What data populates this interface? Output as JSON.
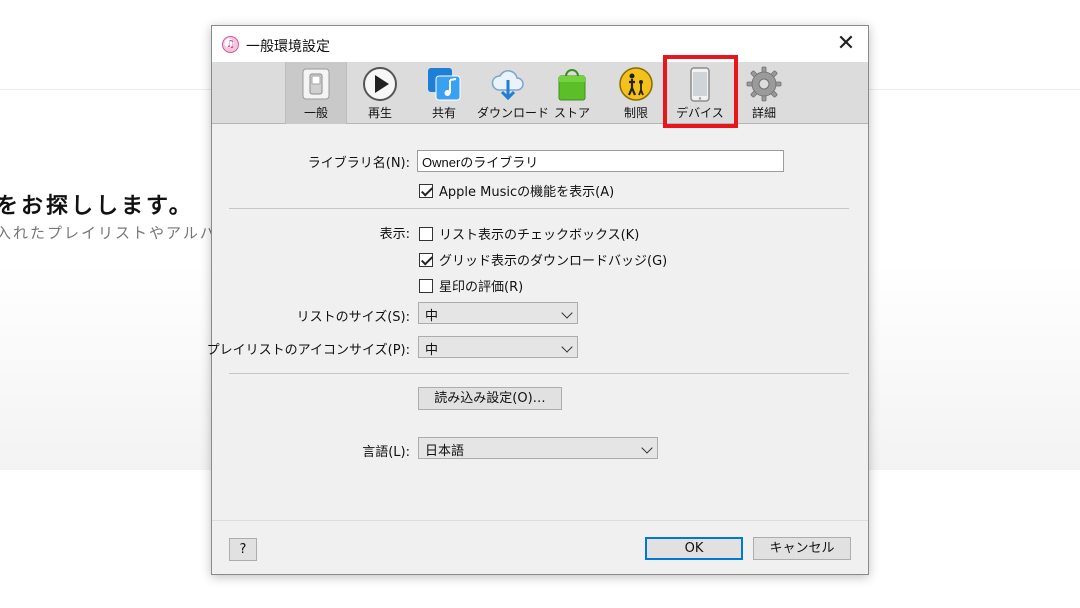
{
  "background": {
    "heading": "をお探しします。",
    "subtext": "入れたプレイリストやアルバ"
  },
  "dialog": {
    "title": "一般環境設定",
    "app_icon": "itunes-note-icon",
    "close_glyph": "✕"
  },
  "toolbar": {
    "items": [
      {
        "label": "一般",
        "icon": "switch-icon"
      },
      {
        "label": "再生",
        "icon": "play-icon"
      },
      {
        "label": "共有",
        "icon": "shared-music-icon"
      },
      {
        "label": "ダウンロード",
        "icon": "cloud-download-icon"
      },
      {
        "label": "ストア",
        "icon": "shopping-bag-icon"
      },
      {
        "label": "制限",
        "icon": "parental-control-icon"
      },
      {
        "label": "デバイス",
        "icon": "phone-icon"
      },
      {
        "label": "詳細",
        "icon": "gear-icon"
      }
    ],
    "active": "一般",
    "highlighted": "デバイス",
    "highlight_color": "#e8151b"
  },
  "general": {
    "library_name_label": "ライブラリ名(N):",
    "library_name_value": "Ownerのライブラリ",
    "apple_music": {
      "label": "Apple Musicの機能を表示(A)",
      "checked": true
    },
    "show_label": "表示:",
    "show_options": [
      {
        "label": "リスト表示のチェックボックス(K)",
        "checked": false
      },
      {
        "label": "グリッド表示のダウンロードバッジ(G)",
        "checked": true
      },
      {
        "label": "星印の評価(R)",
        "checked": false
      }
    ],
    "list_size_label": "リストのサイズ(S):",
    "list_size_value": "中",
    "playlist_icon_size_label": "プレイリストのアイコンサイズ(P):",
    "playlist_icon_size_value": "中",
    "import_settings_button": "読み込み設定(O)…",
    "language_label": "言語(L):",
    "language_value": "日本語"
  },
  "footer": {
    "help_button": "?",
    "ok_button": "OK",
    "cancel_button": "キャンセル"
  }
}
